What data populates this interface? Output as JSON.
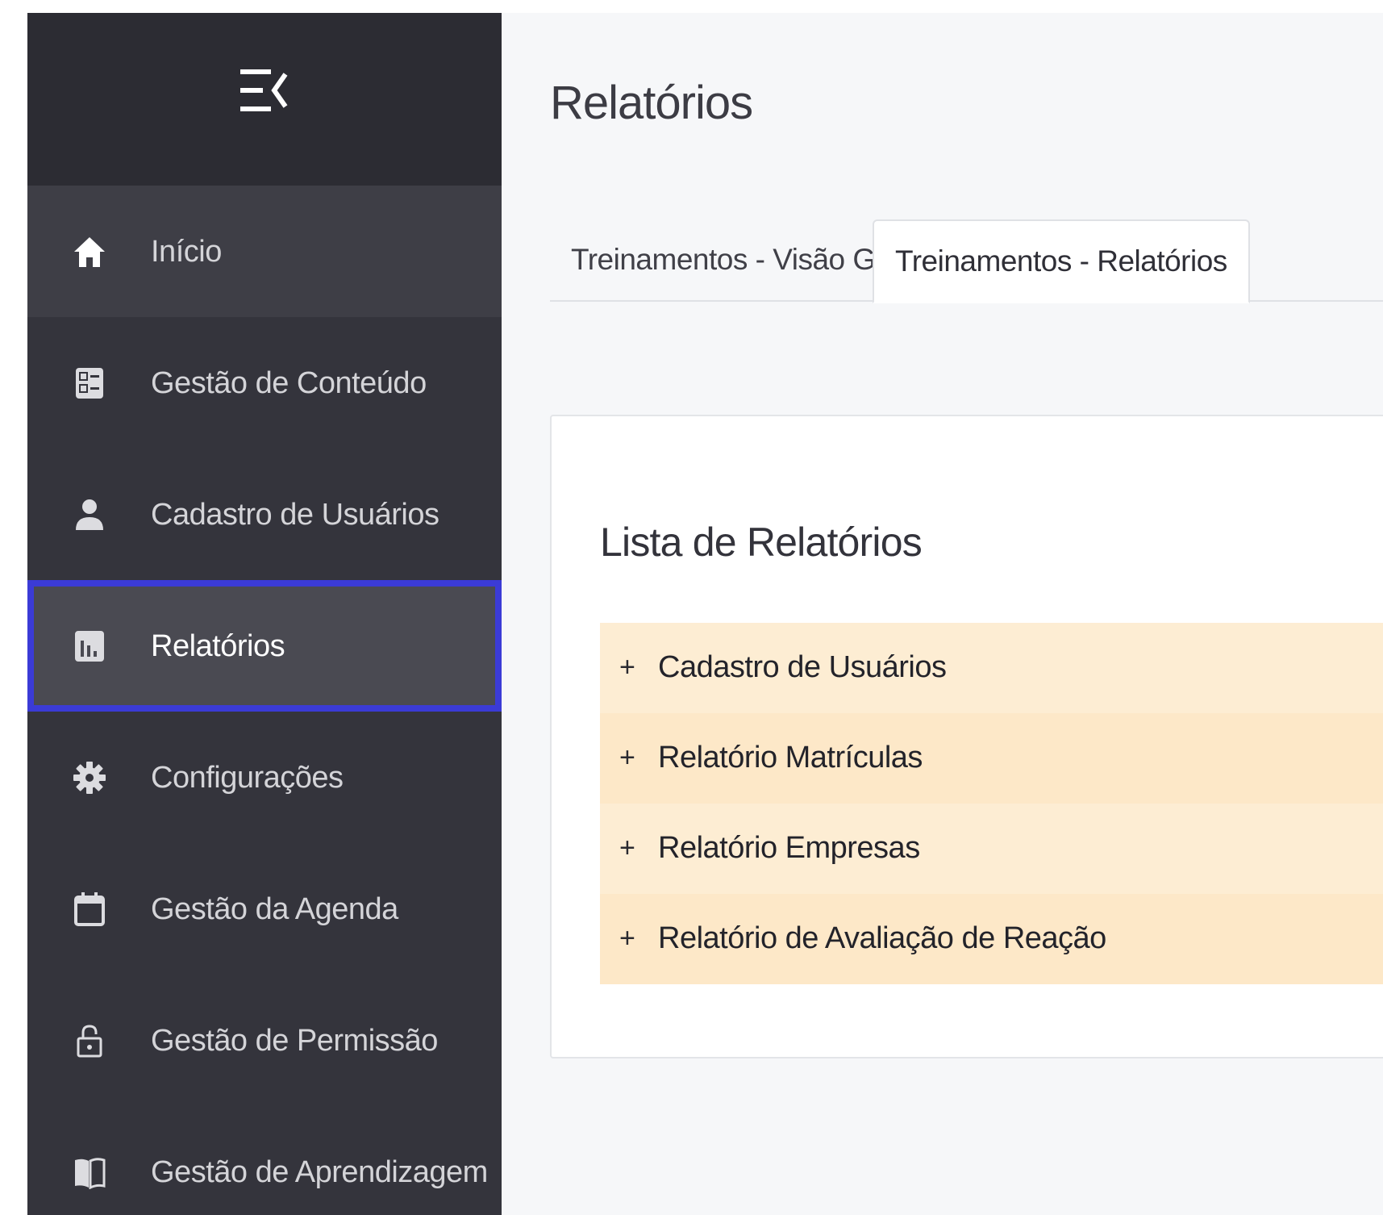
{
  "colors": {
    "sidebar_bg": "#34343c",
    "sidebar_header_bg": "#2c2c33",
    "selected_border": "#3b3bd6",
    "report_row_bg": "#fdedd3",
    "page_bg": "#f6f7f9"
  },
  "sidebar": {
    "toggle_icon": "menu-collapse-icon",
    "items": [
      {
        "label": "Início",
        "icon": "home-icon"
      },
      {
        "label": "Gestão de Conteúdo",
        "icon": "content-list-icon"
      },
      {
        "label": "Cadastro de Usuários",
        "icon": "user-icon"
      },
      {
        "label": "Relatórios",
        "icon": "bar-chart-icon",
        "selected": true
      },
      {
        "label": "Configurações",
        "icon": "gear-icon"
      },
      {
        "label": "Gestão da Agenda",
        "icon": "calendar-icon"
      },
      {
        "label": "Gestão de Permissão",
        "icon": "lock-icon"
      },
      {
        "label": "Gestão de Aprendizagem",
        "icon": "book-icon"
      }
    ]
  },
  "main": {
    "title": "Relatórios",
    "tabs": [
      {
        "label": "Treinamentos - Visão Geral",
        "active": false
      },
      {
        "label": "Treinamentos - Relatórios",
        "active": true
      }
    ],
    "card": {
      "title": "Lista de Relatórios",
      "expand_symbol": "+",
      "items": [
        {
          "label": "Cadastro de Usuários"
        },
        {
          "label": "Relatório Matrículas"
        },
        {
          "label": "Relatório Empresas"
        },
        {
          "label": "Relatório de Avaliação de Reação"
        }
      ]
    }
  }
}
